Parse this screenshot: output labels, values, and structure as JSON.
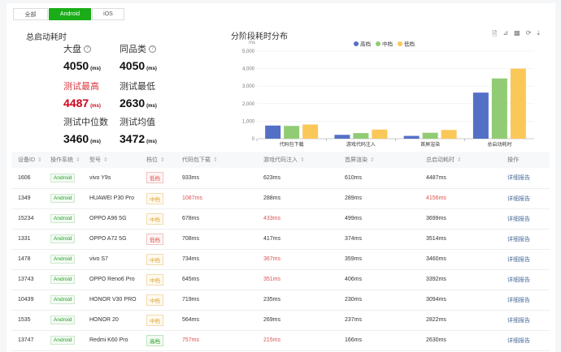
{
  "tabs": [
    "全部",
    "Android",
    "iOS"
  ],
  "active_tab": "Android",
  "summary": {
    "title": "总启动耗时",
    "unit": "(ms)",
    "stats": [
      {
        "label": "大盘",
        "value": "4050",
        "help": true
      },
      {
        "label": "同品类",
        "value": "4050",
        "help": true
      },
      {
        "label": "测试最高",
        "value": "4487",
        "highlight": true
      },
      {
        "label": "测试最低",
        "value": "2630"
      },
      {
        "label": "测试中位数",
        "value": "3460"
      },
      {
        "label": "测试均值",
        "value": "3472"
      }
    ]
  },
  "chart_data": {
    "type": "bar",
    "title": "分阶段耗时分布",
    "ylabel": "ms",
    "ylim": [
      0,
      5000
    ],
    "yticks": [
      "0",
      "1,000",
      "2,000",
      "3,000",
      "4,000",
      "5,000"
    ],
    "categories": [
      "代码包下载",
      "游戏代码注入",
      "首屏渲染",
      "总启动耗时"
    ],
    "legend_position": "top",
    "grid": true,
    "series": [
      {
        "name": "高档",
        "color": "#5470c6",
        "values": [
          750,
          220,
          160,
          2630
        ]
      },
      {
        "name": "中档",
        "color": "#91cc75",
        "values": [
          730,
          320,
          340,
          3440
        ]
      },
      {
        "name": "低档",
        "color": "#fac858",
        "values": [
          810,
          520,
          500,
          4000
        ]
      }
    ]
  },
  "toolbox_icons": [
    "data-view-icon",
    "line-chart-icon",
    "bar-chart-icon",
    "restore-icon",
    "download-icon"
  ],
  "table": {
    "headers": [
      "设备ID",
      "操作系统",
      "型号",
      "档位",
      "代码包下载",
      "游戏代码注入",
      "首屏渲染",
      "总启动耗时",
      "操作"
    ],
    "rows": [
      {
        "id": "1606",
        "os": "Android",
        "model": "vivo Y9s",
        "tier": "低档",
        "tier_class": "low",
        "code": "933ms",
        "inject": "623ms",
        "render": "610ms",
        "total": "4487ms",
        "action": "详细报告",
        "red": []
      },
      {
        "id": "1349",
        "os": "Android",
        "model": "HUAWEI P30 Pro",
        "tier": "中档",
        "tier_class": "mid",
        "code": "1087ms",
        "inject": "288ms",
        "render": "289ms",
        "total": "4156ms",
        "action": "详细报告",
        "red": [
          "code",
          "total"
        ]
      },
      {
        "id": "15234",
        "os": "Android",
        "model": "OPPO A96 5G",
        "tier": "中档",
        "tier_class": "mid",
        "code": "678ms",
        "inject": "433ms",
        "render": "499ms",
        "total": "3699ms",
        "action": "详细报告",
        "red": [
          "inject"
        ]
      },
      {
        "id": "1331",
        "os": "Android",
        "model": "OPPO A72 5G",
        "tier": "低档",
        "tier_class": "low",
        "code": "708ms",
        "inject": "417ms",
        "render": "374ms",
        "total": "3514ms",
        "action": "详细报告",
        "red": []
      },
      {
        "id": "1478",
        "os": "Android",
        "model": "vivo S7",
        "tier": "中档",
        "tier_class": "mid",
        "code": "734ms",
        "inject": "367ms",
        "render": "359ms",
        "total": "3460ms",
        "action": "详细报告",
        "red": [
          "inject"
        ]
      },
      {
        "id": "13743",
        "os": "Android",
        "model": "OPPO Reno6 Pro",
        "tier": "中档",
        "tier_class": "mid",
        "code": "645ms",
        "inject": "351ms",
        "render": "406ms",
        "total": "3392ms",
        "action": "详细报告",
        "red": [
          "inject"
        ]
      },
      {
        "id": "10439",
        "os": "Android",
        "model": "HONOR V30 PRO",
        "tier": "中档",
        "tier_class": "mid",
        "code": "719ms",
        "inject": "235ms",
        "render": "230ms",
        "total": "3094ms",
        "action": "详细报告",
        "red": []
      },
      {
        "id": "1535",
        "os": "Android",
        "model": "HONOR 20",
        "tier": "中档",
        "tier_class": "mid",
        "code": "564ms",
        "inject": "269ms",
        "render": "237ms",
        "total": "2822ms",
        "action": "详细报告",
        "red": []
      },
      {
        "id": "13747",
        "os": "Android",
        "model": "Redmi K60 Pro",
        "tier": "高档",
        "tier_class": "high",
        "code": "757ms",
        "inject": "215ms",
        "render": "166ms",
        "total": "2630ms",
        "action": "详细报告",
        "red": [
          "code",
          "inject"
        ]
      }
    ]
  }
}
